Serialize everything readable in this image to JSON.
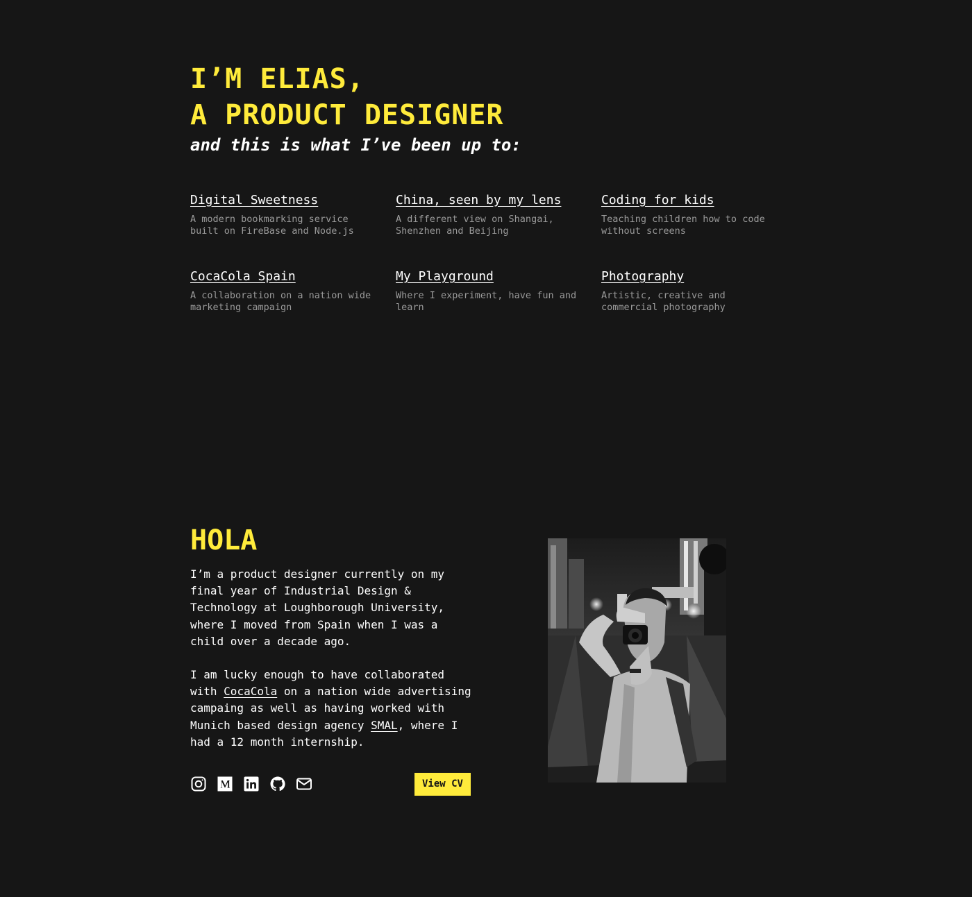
{
  "hero": {
    "line1": "I’M ELIAS,",
    "line2": "A PRODUCT DESIGNER",
    "subtitle": "and this is what I’ve been up to:"
  },
  "projects": [
    {
      "title": "Digital Sweetness",
      "description": "A modern bookmarking service built on FireBase and Node.js"
    },
    {
      "title": "China, seen by my lens",
      "description": "A different view on Shangai, Shenzhen and Beijing"
    },
    {
      "title": "Coding for kids",
      "description": "Teaching children how to code without screens"
    },
    {
      "title": "CocaCola Spain",
      "description": "A collaboration on a nation wide marketing campaign"
    },
    {
      "title": "My Playground",
      "description": "Where I experiment, have fun and learn"
    },
    {
      "title": "Photography",
      "description": "Artistic, creative and commercial photography"
    }
  ],
  "about": {
    "title": "HOLA",
    "paragraph1": "I’m a product designer currently on my final year of Industrial Design & Technology at Loughborough University, where I moved from Spain when I was a child over a decade ago.",
    "paragraph2_part1": "I am lucky enough to have collaborated with ",
    "link_cocacola": "CocaCola",
    "paragraph2_part2": " on a nation wide advertising campaing as well as having worked with Munich based design agency ",
    "link_smal": "SMAL",
    "paragraph2_part3": ", where I had a 12 month internship."
  },
  "socials": [
    {
      "icon": "instagram-icon"
    },
    {
      "icon": "medium-icon"
    },
    {
      "icon": "linkedin-icon"
    },
    {
      "icon": "github-icon"
    },
    {
      "icon": "mail-icon"
    }
  ],
  "cv_button_label": "View CV",
  "colors": {
    "background": "#161616",
    "accent": "#ffeb3b",
    "text": "#ffffff",
    "muted": "#9a9a9a"
  }
}
